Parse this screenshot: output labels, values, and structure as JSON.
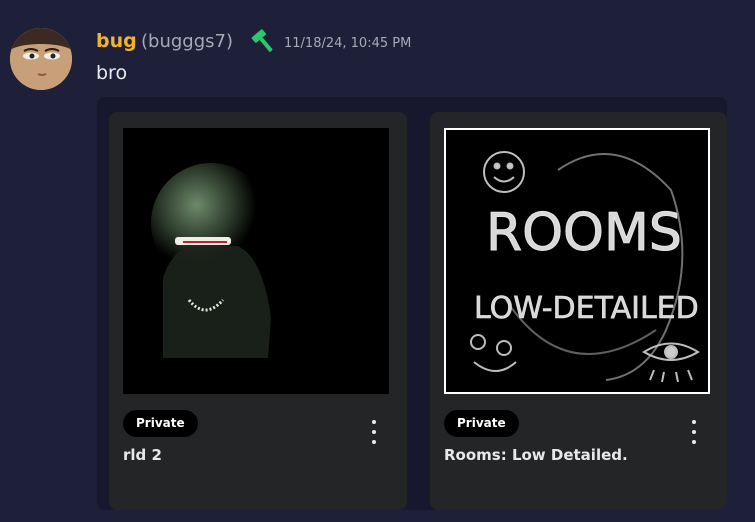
{
  "message": {
    "username": "bug",
    "handle": "(bugggs7)",
    "timestamp": "11/18/24, 10:45 PM",
    "text": "bro",
    "username_color": "#f0b232",
    "role_icon": "gavel-icon",
    "role_icon_color": "#2dc770"
  },
  "cards": [
    {
      "badge": "Private",
      "title": "rld 2",
      "thumbnail": "dark-green-creature-thumbnail"
    },
    {
      "badge": "Private",
      "title": "Rooms: Low Detailed.",
      "thumbnail": "rooms-sketch-thumbnail",
      "thumbnail_text": {
        "line1": "ROOMS",
        "line2": "LOW-DETAILED"
      }
    }
  ]
}
